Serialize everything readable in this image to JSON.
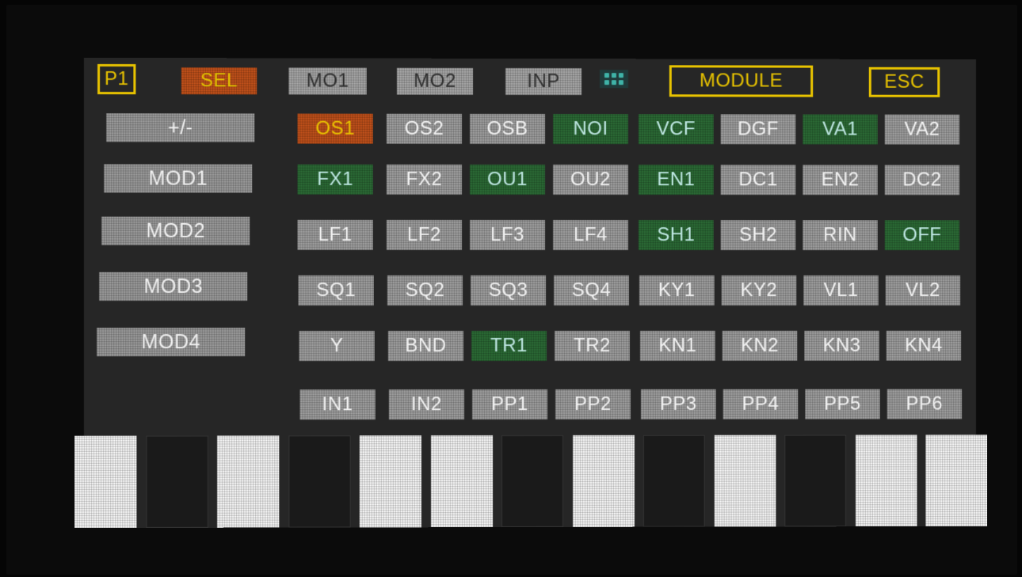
{
  "top_bar": {
    "p1": "P1",
    "sel": "SEL",
    "mo1": "MO1",
    "mo2": "MO2",
    "inp": "INP",
    "module": "MODULE",
    "esc": "ESC",
    "dots_icon": "dots-grid-icon"
  },
  "side_buttons": [
    "+/-",
    "MOD1",
    "MOD2",
    "MOD3",
    "MOD4"
  ],
  "grid": [
    [
      {
        "label": "OS1",
        "state": "selected"
      },
      {
        "label": "OS2",
        "state": "gray"
      },
      {
        "label": "OSB",
        "state": "gray"
      },
      {
        "label": "NOI",
        "state": "green"
      },
      {
        "label": "VCF",
        "state": "green"
      },
      {
        "label": "DGF",
        "state": "gray"
      },
      {
        "label": "VA1",
        "state": "green"
      },
      {
        "label": "VA2",
        "state": "gray"
      }
    ],
    [
      {
        "label": "FX1",
        "state": "green"
      },
      {
        "label": "FX2",
        "state": "gray"
      },
      {
        "label": "OU1",
        "state": "green"
      },
      {
        "label": "OU2",
        "state": "gray"
      },
      {
        "label": "EN1",
        "state": "green"
      },
      {
        "label": "DC1",
        "state": "gray"
      },
      {
        "label": "EN2",
        "state": "gray"
      },
      {
        "label": "DC2",
        "state": "gray"
      }
    ],
    [
      {
        "label": "LF1",
        "state": "gray"
      },
      {
        "label": "LF2",
        "state": "gray"
      },
      {
        "label": "LF3",
        "state": "gray"
      },
      {
        "label": "LF4",
        "state": "gray"
      },
      {
        "label": "SH1",
        "state": "green"
      },
      {
        "label": "SH2",
        "state": "gray"
      },
      {
        "label": "RIN",
        "state": "gray"
      },
      {
        "label": "OFF",
        "state": "green"
      }
    ],
    [
      {
        "label": "SQ1",
        "state": "gray"
      },
      {
        "label": "SQ2",
        "state": "gray"
      },
      {
        "label": "SQ3",
        "state": "gray"
      },
      {
        "label": "SQ4",
        "state": "gray"
      },
      {
        "label": "KY1",
        "state": "gray"
      },
      {
        "label": "KY2",
        "state": "gray"
      },
      {
        "label": "VL1",
        "state": "gray"
      },
      {
        "label": "VL2",
        "state": "gray"
      }
    ],
    [
      {
        "label": "Y",
        "state": "gray"
      },
      {
        "label": "BND",
        "state": "gray"
      },
      {
        "label": "TR1",
        "state": "green"
      },
      {
        "label": "TR2",
        "state": "gray"
      },
      {
        "label": "KN1",
        "state": "gray"
      },
      {
        "label": "KN2",
        "state": "gray"
      },
      {
        "label": "KN3",
        "state": "gray"
      },
      {
        "label": "KN4",
        "state": "gray"
      }
    ],
    [
      {
        "label": "IN1",
        "state": "gray"
      },
      {
        "label": "IN2",
        "state": "gray"
      },
      {
        "label": "PP1",
        "state": "gray"
      },
      {
        "label": "PP2",
        "state": "gray"
      },
      {
        "label": "PP3",
        "state": "gray"
      },
      {
        "label": "PP4",
        "state": "gray"
      },
      {
        "label": "PP5",
        "state": "gray"
      },
      {
        "label": "PP6",
        "state": "gray"
      }
    ]
  ],
  "keyboard": [
    "white",
    "dark",
    "white",
    "dark",
    "white",
    "white",
    "dark",
    "white",
    "dark",
    "white",
    "dark",
    "white",
    "white"
  ],
  "colors": {
    "yellow": "#e8c300",
    "orange": "#c0501a",
    "green": "#2b6a35",
    "gray": "#9e9e9e"
  }
}
